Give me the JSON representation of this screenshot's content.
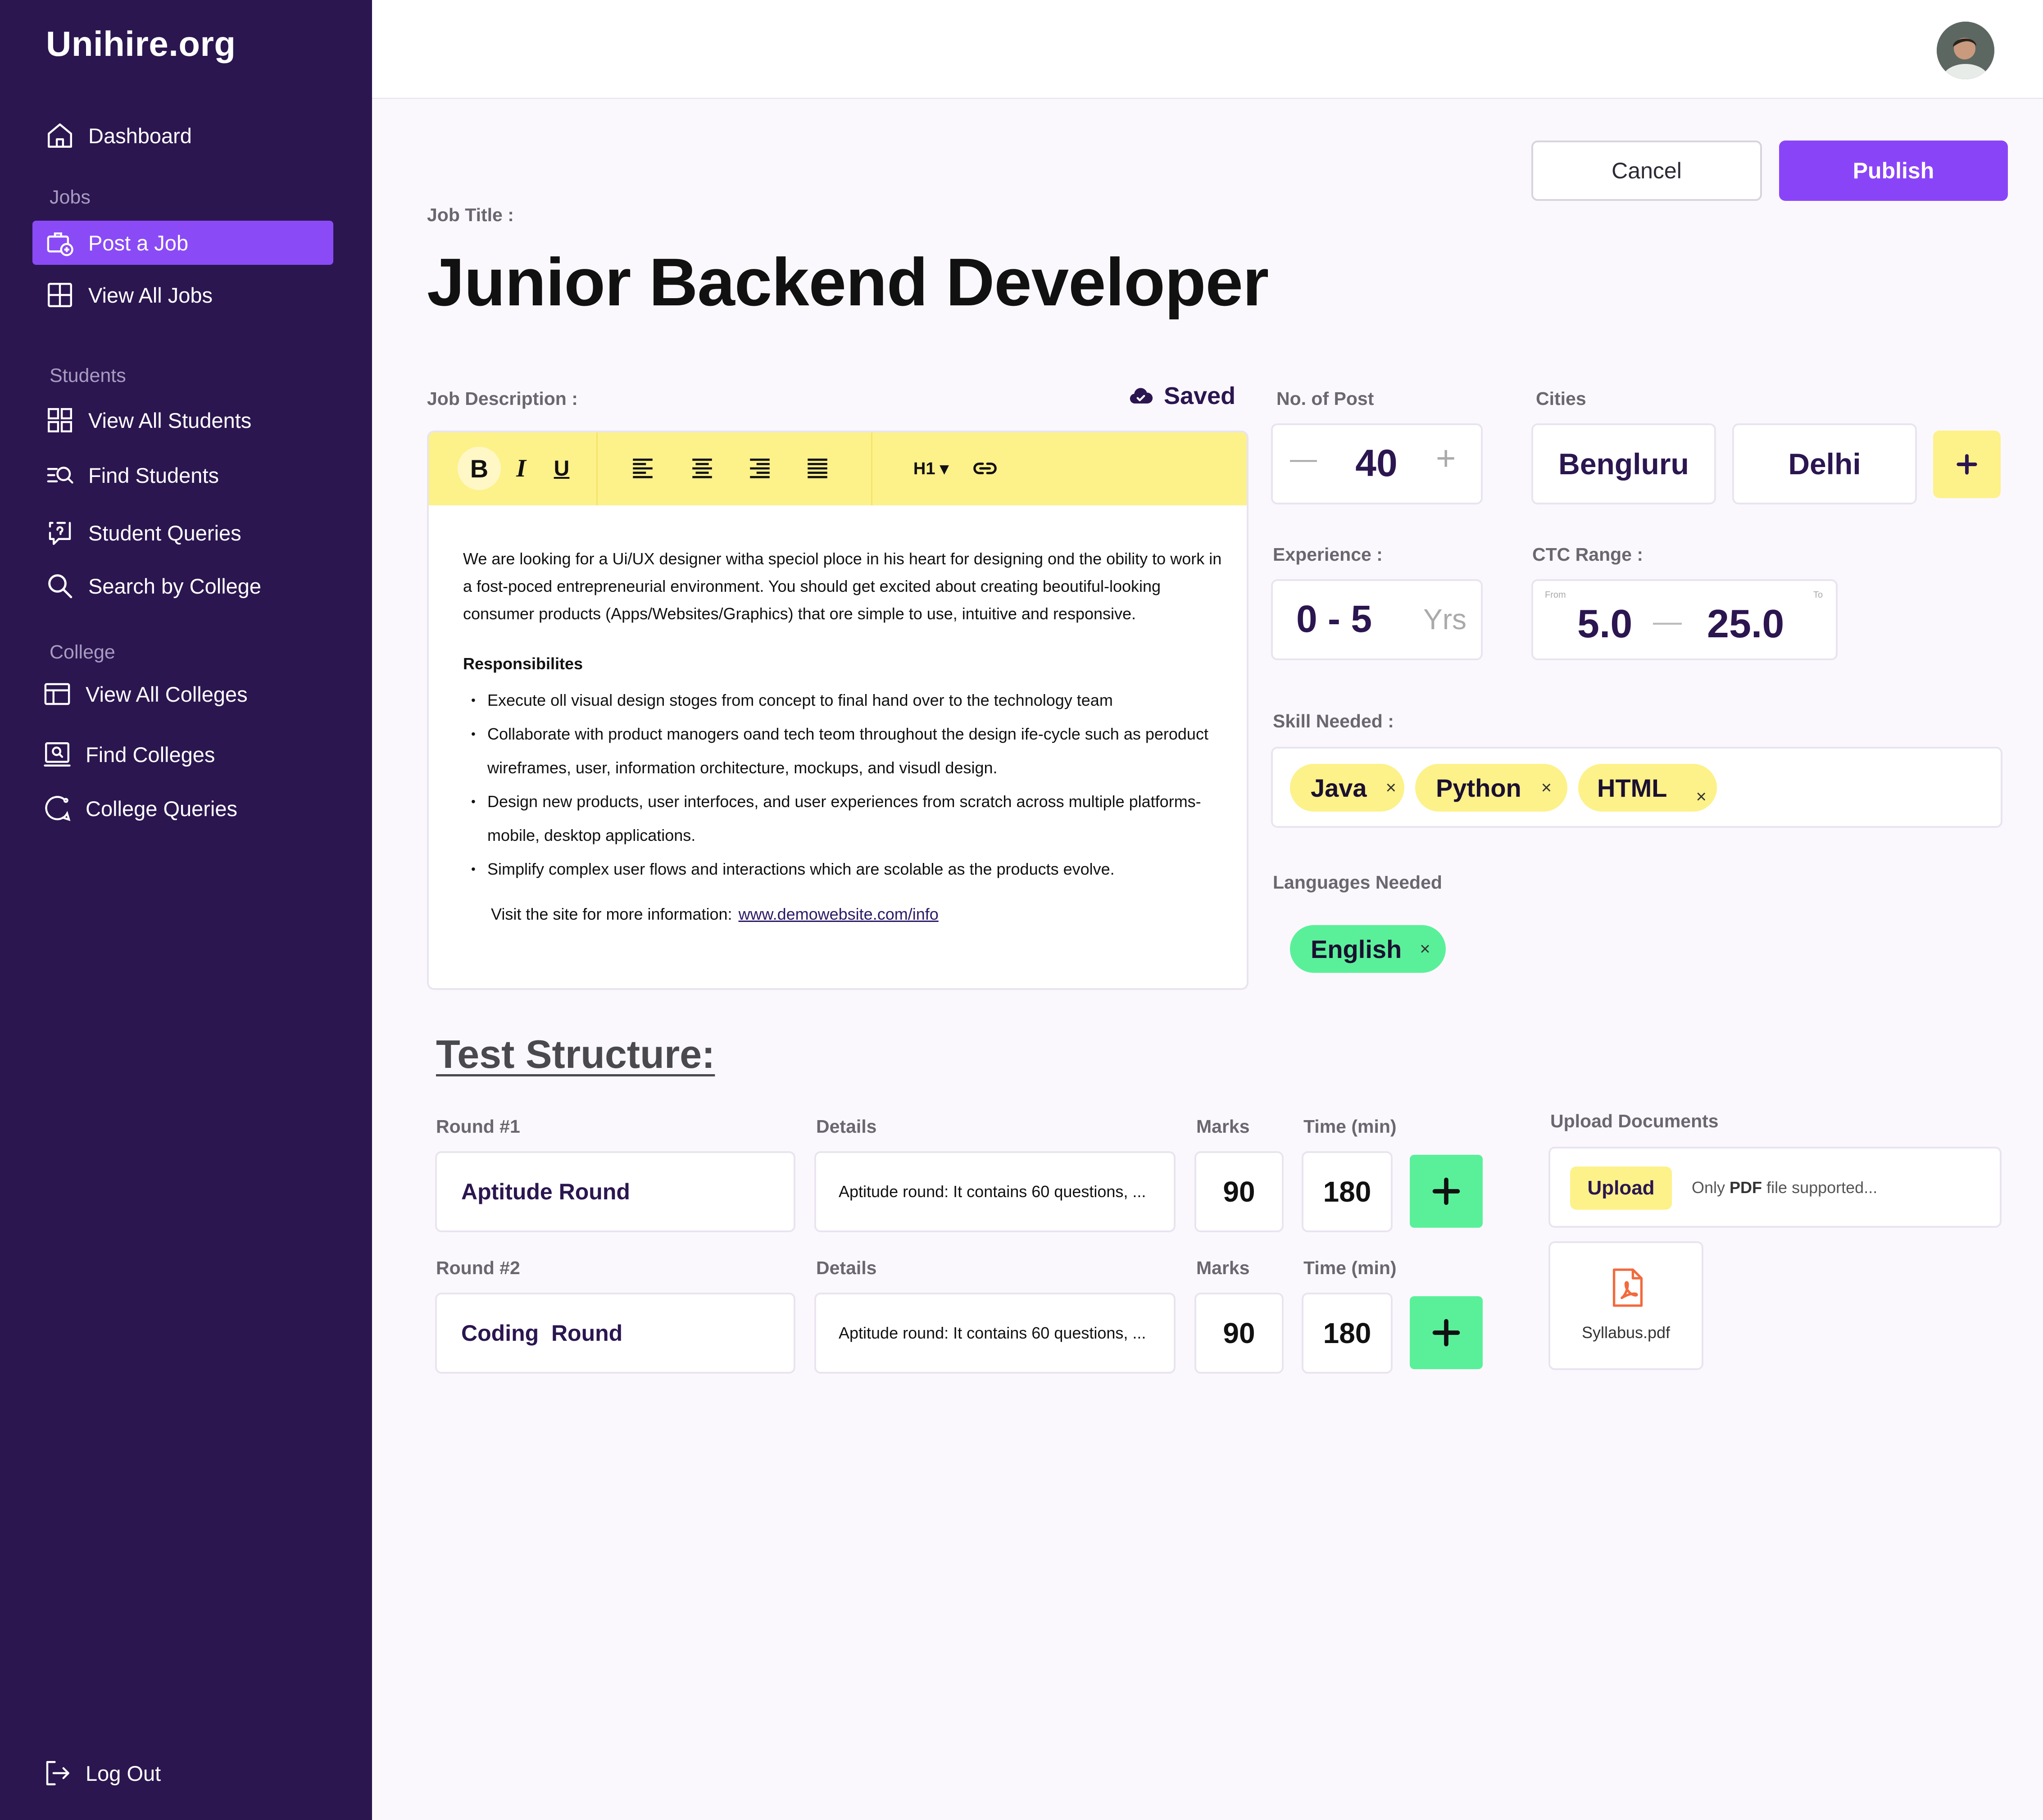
{
  "brand": {
    "name": "Unihire.org"
  },
  "sidebar": {
    "dashboard": "Dashboard",
    "sections": {
      "jobs": "Jobs",
      "students": "Students",
      "college": "College"
    },
    "items": {
      "post_job": "Post a Job",
      "view_jobs": "View All Jobs",
      "view_students": "View All Students",
      "find_students": "Find Students",
      "student_queries": "Student Queries",
      "search_college": "Search by College",
      "view_colleges": "View All Colleges",
      "find_colleges": "Find Colleges",
      "college_queries": "College Queries"
    },
    "logout": "Log Out"
  },
  "actions": {
    "cancel": "Cancel",
    "publish": "Publish"
  },
  "job": {
    "title_label": "Job Title :",
    "title": "Junior Backend Developer",
    "description_label": "Job Description :",
    "saved": "Saved"
  },
  "editor": {
    "toolbar": {
      "bold": "B",
      "italic": "I",
      "underline": "U",
      "heading": "H1 ▾"
    },
    "intro": "We are looking for a Ui/UX designer witha speciol ploce in his heart for designing ond the obility to work in a fost-poced entrepreneurial environment. You should get excited about creating beoutiful-looking consumer products (Apps/Websites/Graphics) that ore simple to use, intuitive and responsive.",
    "responsibilities_title": "Responsibilites",
    "responsibilities": [
      "Execute oll visual design stoges from concept to final hand over to the technology team",
      "Collaborate with product manogers oand tech teom throughout the design ife-cycle such as peroduct wireframes, user, information orchitecture, mockups, and visudl design.",
      "Design new products, user interfoces, and user experiences from scratch across multiple platforms-mobile, desktop applications.",
      "Simplify complex user flows and interactions which are scolable as the products evolve."
    ],
    "visit_text": "Visit the site for more information:",
    "visit_link": "www.demowebsite.com/info"
  },
  "posts": {
    "label": "No. of Post",
    "value": "40",
    "minus": "—",
    "plus": "+"
  },
  "cities": {
    "label": "Cities",
    "items": [
      "Bengluru",
      "Delhi"
    ],
    "add": "+"
  },
  "experience": {
    "label": "Experience :",
    "value": "0 - 5",
    "unit": "Yrs"
  },
  "ctc": {
    "label": "CTC Range :",
    "from_label": "From",
    "to_label": "To",
    "from": "5.0",
    "to": "25.0",
    "sep": "—"
  },
  "skills": {
    "label": "Skill Needed :",
    "items": [
      "Java",
      "Python",
      "HTML"
    ],
    "remove": "×"
  },
  "languages": {
    "label": "Languages Needed",
    "items": [
      "English"
    ],
    "remove": "×"
  },
  "test": {
    "title": "Test Structure:",
    "details_label": "Details",
    "marks_label": "Marks",
    "time_label": "Time (min)",
    "add": "+",
    "rounds": [
      {
        "label": "Round #1",
        "name": "Aptitude Round",
        "details": "Aptitude round: It contains 60 questions, ...",
        "marks": "90",
        "time": "180"
      },
      {
        "label": "Round #2",
        "name": "Coding  Round",
        "details": "Aptitude round: It contains 60 questions, ...",
        "marks": "90",
        "time": "180"
      }
    ]
  },
  "upload": {
    "label": "Upload Documents",
    "button": "Upload",
    "note_prefix": "Only",
    "note_bold": "PDF",
    "note_suffix": "file supported...",
    "file": "Syllabus.pdf"
  },
  "colors": {
    "sidebar": "#2b1650",
    "accent": "#8a44f8",
    "yellow": "#fdf18a",
    "green": "#5af09a",
    "background": "#fbf8fd"
  }
}
